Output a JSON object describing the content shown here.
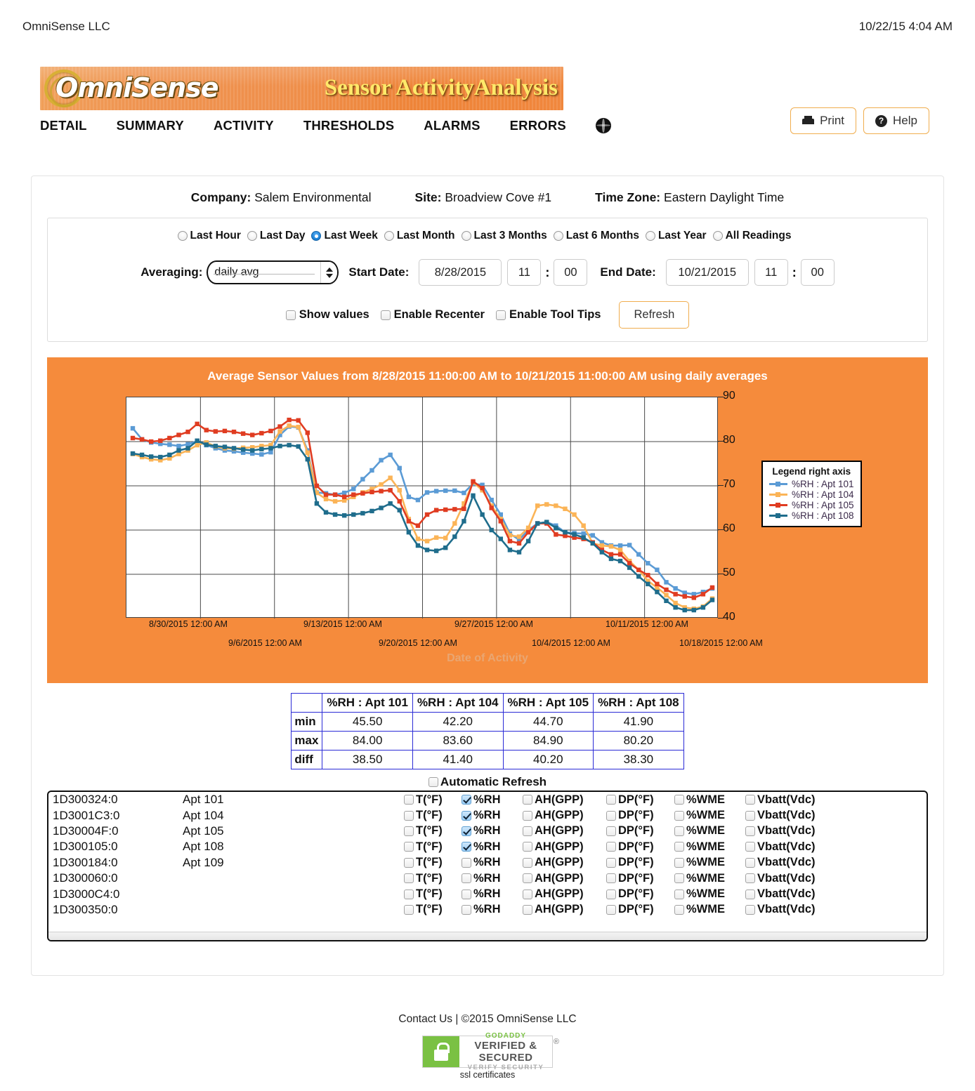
{
  "topbar": {
    "company": "OmniSense LLC",
    "datetime": "10/22/15 4:04 AM"
  },
  "banner": {
    "logo": "OmniSense",
    "tagline": "Sensor ActivityAnalysis"
  },
  "nav": {
    "items": [
      "DETAIL",
      "SUMMARY",
      "ACTIVITY",
      "THRESHOLDS",
      "ALARMS",
      "ERRORS"
    ],
    "globe_icon": "globe-icon"
  },
  "topbuttons": {
    "print": "Print",
    "help": "Help"
  },
  "meta": {
    "company_label": "Company:",
    "company_value": "Salem Environmental",
    "site_label": "Site:",
    "site_value": "Broadview Cove #1",
    "tz_label": "Time Zone:",
    "tz_value": "Eastern Daylight Time"
  },
  "range": {
    "options": [
      "Last Hour",
      "Last Day",
      "Last Week",
      "Last Month",
      "Last 3 Months",
      "Last 6 Months",
      "Last Year",
      "All Readings"
    ],
    "selected": "Last Week"
  },
  "form": {
    "averaging_label": "Averaging:",
    "averaging_value": "daily avg",
    "start_label": "Start Date:",
    "start_date": "8/28/2015",
    "start_hour": "11",
    "start_min": "00",
    "end_label": "End Date:",
    "end_date": "10/21/2015",
    "end_hour": "11",
    "end_min": "00",
    "colon": ":",
    "show_values": "Show values",
    "enable_recenter": "Enable Recenter",
    "enable_tooltips": "Enable Tool Tips",
    "refresh": "Refresh"
  },
  "chart_data": {
    "type": "line",
    "title": "Average Sensor Values from 8/28/2015 11:00:00 AM to 10/21/2015 11:00:00 AM using daily averages",
    "xlabel": "Date of Activity",
    "ylabel": "",
    "ylim": [
      40,
      90
    ],
    "yticks": [
      40,
      50,
      60,
      70,
      80,
      90
    ],
    "grid": true,
    "legend_position": "right",
    "legend_title": "Legend right axis",
    "xtick_labels_top": [
      "8/30/2015 12:00 AM",
      "9/13/2015 12:00 AM",
      "9/27/2015 12:00 AM",
      "10/11/2015 12:00 AM"
    ],
    "xtick_labels_bottom": [
      "9/6/2015 12:00 AM",
      "9/20/2015 12:00 AM",
      "10/4/2015 12:00 AM",
      "10/18/2015 12:00 AM"
    ],
    "colors": {
      "apt101": "#5b9bd5",
      "apt104": "#fbb457",
      "apt105": "#e03c21",
      "apt108": "#1f6d8c"
    },
    "series": [
      {
        "name": "%RH : Apt 101",
        "color": "#5b9bd5",
        "values": [
          83.0,
          80.5,
          79.8,
          79.5,
          79.3,
          79.0,
          79.4,
          80.1,
          79.2,
          78.5,
          78.0,
          77.8,
          77.5,
          77.3,
          77.1,
          77.6,
          81.5,
          83.4,
          83.2,
          78.0,
          68.5,
          68.3,
          68.0,
          68.4,
          69.3,
          71.5,
          73.5,
          75.8,
          77.0,
          74.0,
          67.5,
          66.8,
          68.5,
          68.8,
          68.9,
          68.9,
          68.4,
          70.5,
          70.2,
          66.8,
          63.5,
          59.2,
          57.8,
          60.0,
          61.5,
          61.8,
          61.0,
          59.5,
          59.3,
          59.2,
          58.8,
          57.2,
          56.5,
          56.5,
          56.6,
          54.5,
          52.5,
          51.0,
          48.2,
          46.8,
          45.8,
          45.5,
          46.0,
          46.8
        ]
      },
      {
        "name": "%RH : Apt 104",
        "color": "#fbb457",
        "values": [
          77.2,
          76.5,
          76.0,
          75.8,
          76.2,
          77.2,
          78.0,
          79.2,
          79.8,
          78.9,
          78.5,
          78.4,
          78.6,
          78.7,
          79.0,
          79.2,
          82.3,
          83.6,
          83.3,
          77.5,
          68.4,
          67.0,
          66.5,
          66.7,
          67.5,
          68.5,
          69.3,
          70.3,
          71.8,
          69.0,
          62.5,
          58.0,
          57.5,
          58.3,
          58.2,
          61.5,
          66.0,
          70.8,
          69.0,
          65.5,
          62.5,
          58.8,
          58.5,
          60.5,
          65.5,
          65.8,
          65.5,
          64.8,
          63.5,
          61.0,
          57.0,
          56.5,
          56.3,
          55.5,
          53.0,
          51.0,
          48.5,
          47.0,
          45.3,
          43.5,
          42.5,
          42.2,
          42.7,
          44.5
        ]
      },
      {
        "name": "%RH : Apt 105",
        "color": "#e03c21",
        "values": [
          80.8,
          80.5,
          80.0,
          80.2,
          80.8,
          81.5,
          82.2,
          84.0,
          82.6,
          82.3,
          82.4,
          82.2,
          81.8,
          81.5,
          81.9,
          82.4,
          83.4,
          84.9,
          84.8,
          82.0,
          70.0,
          68.0,
          68.0,
          67.5,
          68.0,
          68.3,
          68.6,
          68.8,
          69.0,
          66.5,
          62.0,
          61.0,
          63.5,
          64.5,
          64.6,
          64.7,
          64.8,
          71.0,
          69.5,
          65.0,
          62.0,
          57.5,
          57.0,
          59.5,
          61.5,
          61.5,
          59.0,
          58.7,
          58.3,
          58.0,
          57.2,
          55.5,
          54.5,
          54.5,
          52.5,
          51.0,
          49.8,
          47.8,
          46.5,
          45.5,
          45.0,
          44.7,
          45.5,
          47.0
        ]
      },
      {
        "name": "%RH : Apt 108",
        "color": "#1f6d8c",
        "values": [
          77.3,
          77.0,
          76.6,
          76.5,
          77.0,
          78.0,
          78.5,
          80.2,
          79.3,
          79.0,
          78.8,
          78.5,
          78.2,
          78.0,
          78.3,
          78.5,
          79.0,
          79.2,
          78.9,
          76.0,
          66.0,
          64.0,
          63.5,
          63.3,
          63.5,
          63.8,
          64.3,
          65.0,
          66.0,
          64.5,
          59.5,
          56.5,
          55.5,
          55.3,
          56.0,
          58.5,
          62.0,
          67.8,
          63.5,
          60.0,
          58.0,
          55.5,
          55.0,
          57.5,
          61.5,
          61.8,
          60.5,
          59.5,
          59.0,
          58.3,
          57.0,
          55.0,
          53.5,
          53.0,
          51.5,
          49.5,
          47.8,
          46.0,
          44.0,
          42.5,
          41.9,
          41.9,
          42.5,
          44.2
        ]
      }
    ]
  },
  "stats_table": {
    "headers": [
      "",
      "%RH : Apt 101",
      "%RH : Apt 104",
      "%RH : Apt 105",
      "%RH : Apt 108"
    ],
    "rows": [
      {
        "label": "min",
        "values": [
          "45.50",
          "42.20",
          "44.70",
          "41.90"
        ]
      },
      {
        "label": "max",
        "values": [
          "84.00",
          "83.60",
          "84.90",
          "80.20"
        ]
      },
      {
        "label": "diff",
        "values": [
          "38.50",
          "41.40",
          "40.20",
          "38.30"
        ]
      }
    ]
  },
  "auto_refresh": "Automatic Refresh",
  "sensor_columns": [
    "T(°F)",
    "%RH",
    "AH(GPP)",
    "DP(°F)",
    "%WME",
    "Vbatt(Vdc)"
  ],
  "sensors": [
    {
      "id": "1D300324:0",
      "name": "Apt 101",
      "checked": [
        false,
        true,
        false,
        false,
        false,
        false
      ]
    },
    {
      "id": "1D3001C3:0",
      "name": "Apt 104",
      "checked": [
        false,
        true,
        false,
        false,
        false,
        false
      ]
    },
    {
      "id": "1D30004F:0",
      "name": "Apt 105",
      "checked": [
        false,
        true,
        false,
        false,
        false,
        false
      ]
    },
    {
      "id": "1D300105:0",
      "name": "Apt 108",
      "checked": [
        false,
        true,
        false,
        false,
        false,
        false
      ]
    },
    {
      "id": "1D300184:0",
      "name": "Apt 109",
      "checked": [
        false,
        false,
        false,
        false,
        false,
        false
      ]
    },
    {
      "id": "1D300060:0",
      "name": "",
      "checked": [
        false,
        false,
        false,
        false,
        false,
        false
      ]
    },
    {
      "id": "1D3000C4:0",
      "name": "",
      "checked": [
        false,
        false,
        false,
        false,
        false,
        false
      ]
    },
    {
      "id": "1D300350:0",
      "name": "",
      "checked": [
        false,
        false,
        false,
        false,
        false,
        false
      ]
    }
  ],
  "footer": {
    "contact": "Contact Us | ©2015 OmniSense LLC",
    "badge_line1": "GODADDY",
    "badge_line2": "VERIFIED & SECURED",
    "badge_line3": "VERIFY SECURITY",
    "badge_reg": "®",
    "ssl": "ssl certificates"
  }
}
